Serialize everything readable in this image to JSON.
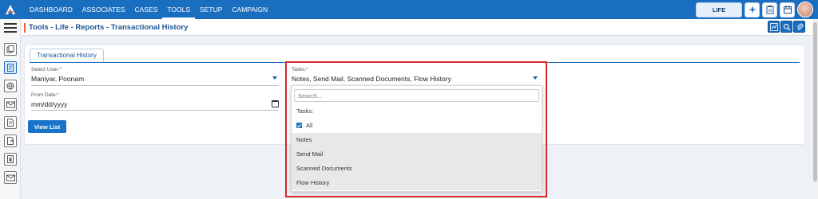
{
  "nav": {
    "items": [
      {
        "label": "DASHBOARD"
      },
      {
        "label": "ASSOCIATES"
      },
      {
        "label": "CASES"
      },
      {
        "label": "TOOLS",
        "active": true
      },
      {
        "label": "SETUP"
      },
      {
        "label": "CAMPAIGN"
      }
    ],
    "product_label": "LIFE"
  },
  "page": {
    "title": "Tools - Life - Reports - Transactional History",
    "tab_label": "Transactional History"
  },
  "form": {
    "select_user": {
      "label": "Select User:",
      "required_mark": "*",
      "value": "Maniyar, Poonam"
    },
    "tasks": {
      "label": "Tasks:",
      "required_mark": "*",
      "value": "Notes, Send Mail, Scanned Documents, Flow History"
    },
    "from_date": {
      "label": "From Date:",
      "required_mark": "*",
      "value": "mm/dd/yyyy"
    },
    "view_button": "View List"
  },
  "dropdown": {
    "search_placeholder": "Search...",
    "group_label": "Tasks:",
    "all_label": "All",
    "all_checked": true,
    "options": [
      {
        "label": "Notes"
      },
      {
        "label": "Send Mail"
      },
      {
        "label": "Scanned Documents"
      },
      {
        "label": "Flow History"
      }
    ]
  },
  "colors": {
    "nav_bg": "#1a6ec0",
    "accent": "#e8683a",
    "primary_button": "#1a73c8",
    "highlight": "#d7262b",
    "title_text": "#1d5692"
  }
}
